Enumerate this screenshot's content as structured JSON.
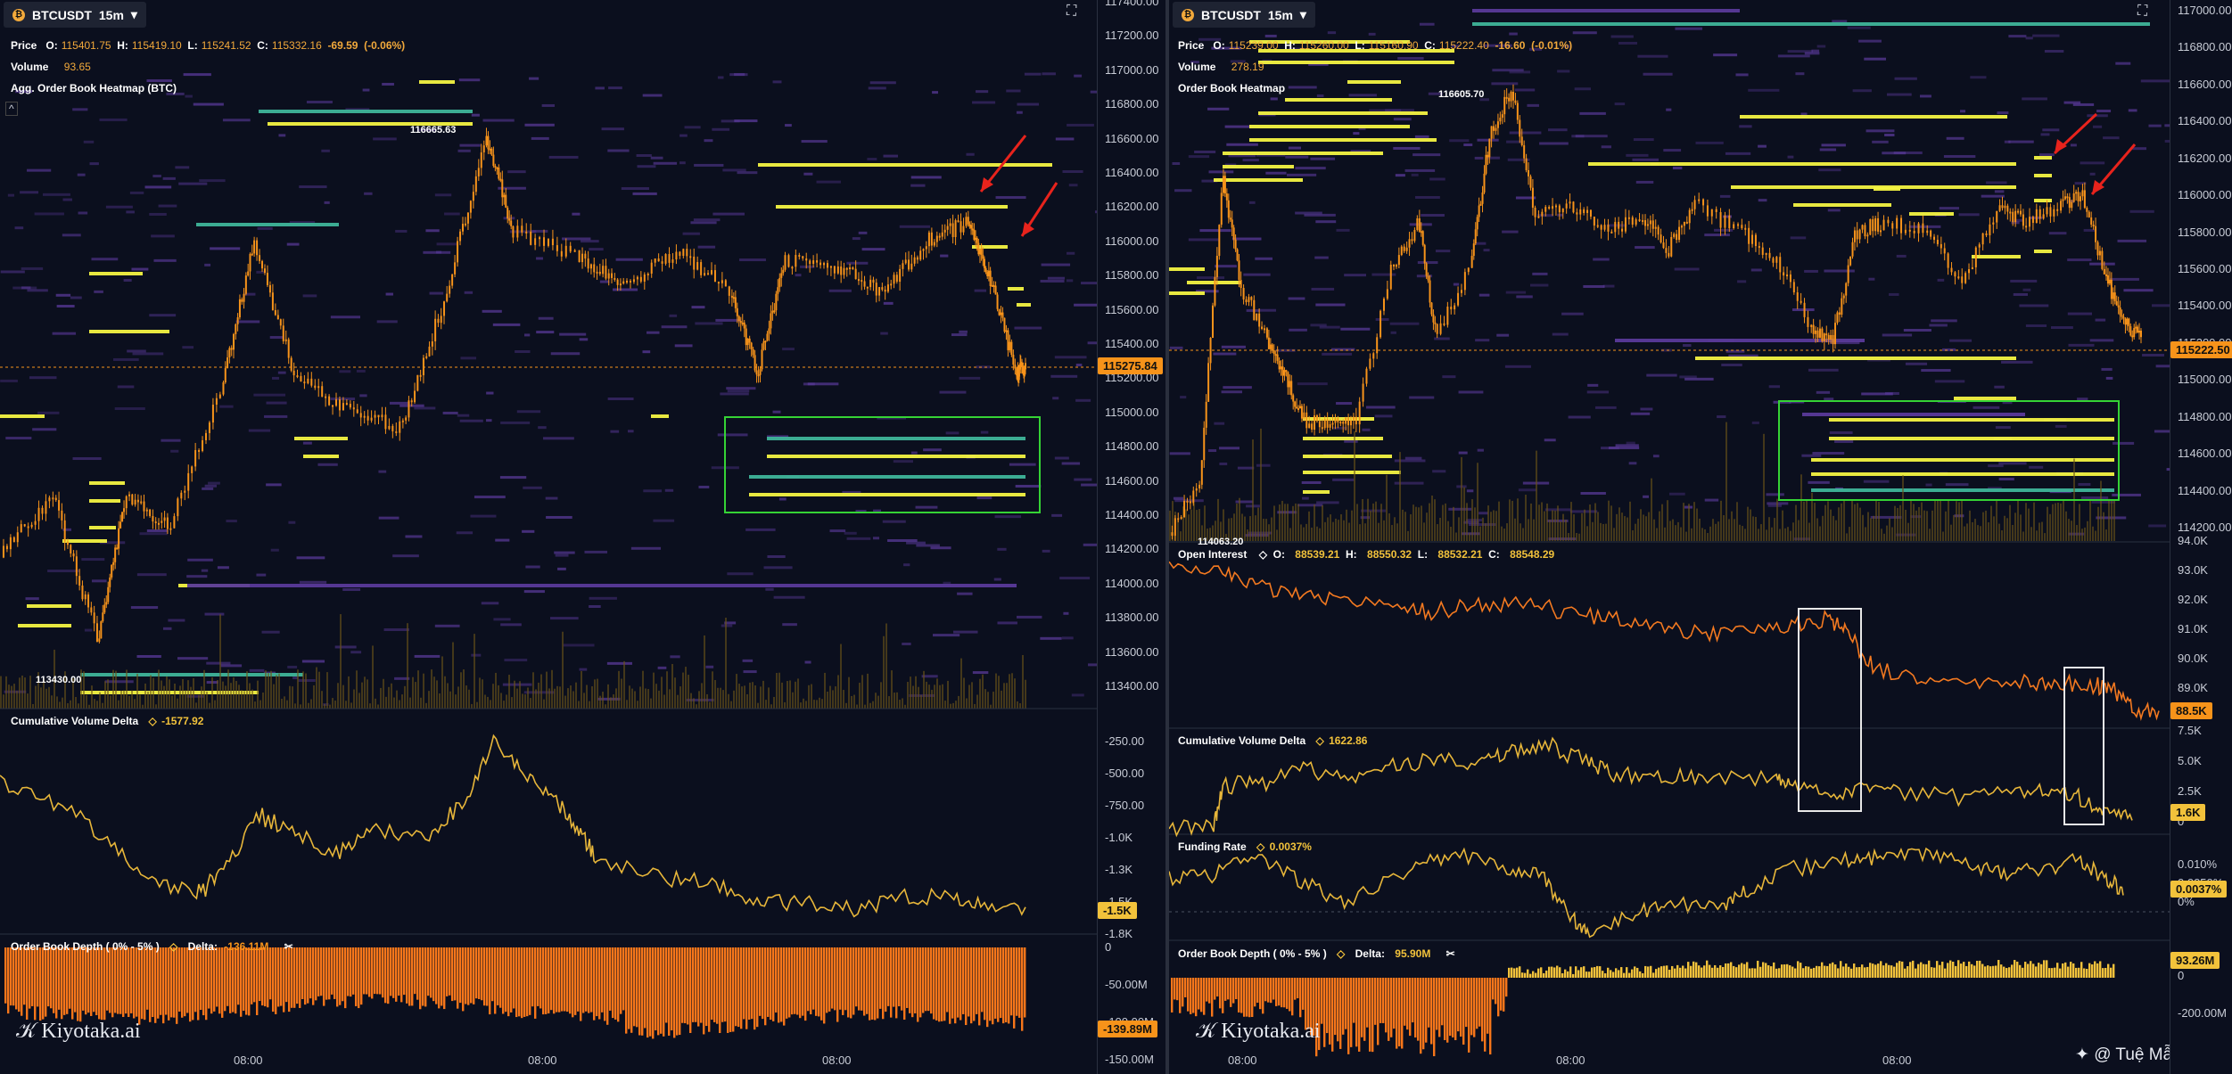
{
  "left": {
    "symbol": "BTCUSDT",
    "interval": "15m",
    "price": {
      "label": "Price",
      "o": "115401.75",
      "h": "115419.10",
      "l": "115241.52",
      "c": "115332.16",
      "chg": "-69.59",
      "pct": "(-0.06%)"
    },
    "volume": {
      "label": "Volume",
      "value": "93.65"
    },
    "overlay_title": "Agg. Order Book Heatmap (BTC)",
    "high_label": "116665.63",
    "low_label": "113430.00",
    "last_price": "115275.84",
    "price_ticks": [
      "117400.00",
      "117200.00",
      "117000.00",
      "116800.00",
      "116600.00",
      "116400.00",
      "116200.00",
      "116000.00",
      "115800.00",
      "115600.00",
      "115400.00",
      "115200.00",
      "115000.00",
      "114800.00",
      "114600.00",
      "114400.00",
      "114200.00",
      "114000.00",
      "113800.00",
      "113600.00",
      "113400.00"
    ],
    "cvd": {
      "title": "Cumulative Volume Delta",
      "value": "-1577.92",
      "ticks": [
        "-250.00",
        "-500.00",
        "-750.00",
        "-1.0K",
        "-1.3K",
        "-1.5K",
        "-1.8K"
      ],
      "badge": "-1.5K"
    },
    "depth": {
      "title": "Order Book Depth ( 0% - 5% )",
      "delta_label": "Delta:",
      "delta": "-136.11M",
      "ticks": [
        "0",
        "-50.00M",
        "-100.00M",
        "-150.00M"
      ],
      "badge": "-139.89M"
    },
    "x_labels": [
      "08:00",
      "08:00",
      "08:00"
    ],
    "watermark": "Kiyotaka.ai"
  },
  "right": {
    "symbol": "BTCUSDT",
    "interval": "15m",
    "price": {
      "label": "Price",
      "o": "115239.00",
      "h": "115260.00",
      "l": "115160.90",
      "c": "115222.40",
      "chg": "-16.60",
      "pct": "(-0.01%)"
    },
    "volume": {
      "label": "Volume",
      "value": "278.19"
    },
    "overlay_title": "Order Book Heatmap",
    "high_label": "116605.70",
    "low_label": "114063.20",
    "last_price": "115222.50",
    "price_ticks": [
      "117000.00",
      "116800.00",
      "116600.00",
      "116400.00",
      "116200.00",
      "116000.00",
      "115800.00",
      "115600.00",
      "115400.00",
      "115200.00",
      "115000.00",
      "114800.00",
      "114600.00",
      "114400.00",
      "114200.00"
    ],
    "oi": {
      "title": "Open Interest",
      "o": "88539.21",
      "h": "88550.32",
      "l": "88532.21",
      "c": "88548.29",
      "ticks": [
        "94.0K",
        "93.0K",
        "92.0K",
        "91.0K",
        "90.0K",
        "89.0K"
      ],
      "badge": "88.5K"
    },
    "cvd": {
      "title": "Cumulative Volume Delta",
      "value": "1622.86",
      "ticks": [
        "7.5K",
        "5.0K",
        "2.5K",
        "0"
      ],
      "badge": "1.6K"
    },
    "funding": {
      "title": "Funding Rate",
      "value": "0.0037%",
      "ticks": [
        "0.010%",
        "0.0050%",
        "0%"
      ],
      "badge": "0.0037%"
    },
    "depth": {
      "title": "Order Book Depth ( 0% - 5% )",
      "delta_label": "Delta:",
      "delta": "95.90M",
      "ticks": [
        "0",
        "-200.00M"
      ],
      "badge": "93.26M"
    },
    "x_labels": [
      "08:00",
      "08:00",
      "08:00"
    ],
    "watermark": "Kiyotaka.ai"
  },
  "footer": {
    "author": "@ Tuệ Mẫn"
  },
  "colors": {
    "candle": "#f7931a",
    "heat_yellow": "#f4f442",
    "heat_teal": "#3fb59a",
    "heat_purple": "#5a3a9a",
    "box": "#35d335",
    "arrow": "#e8231c",
    "badge": "#f7931a"
  }
}
